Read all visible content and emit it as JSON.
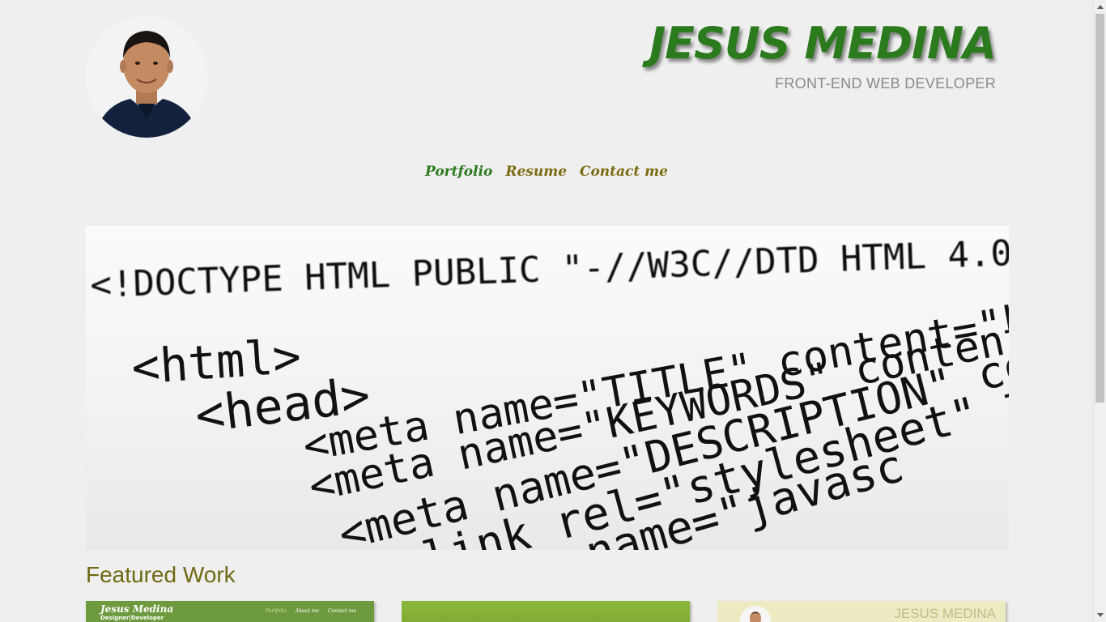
{
  "header": {
    "name": "JESUS MEDINA",
    "subtitle": "FRONT-END WEB DEVELOPER"
  },
  "nav": {
    "items": [
      {
        "label": "Portfolio",
        "active": true
      },
      {
        "label": "Resume",
        "active": false
      },
      {
        "label": "Contact me",
        "active": false
      }
    ]
  },
  "hero": {
    "code_lines": [
      "<!DOCTYPE HTML PUBLIC \"-//W3C//DTD HTML 4.0",
      "<html>",
      "<head>",
      "<meta name=\"TITLE\" content=\"keywords",
      "<meta name=\"KEYWORDS\" content=\"st",
      "<meta name=\"DESCRIPTION\" conte",
      "<link rel=\"stylesheet\" type=",
      "<meta name=\"javasc"
    ]
  },
  "featured": {
    "heading": "Featured Work",
    "thumbs": [
      {
        "title": "Jesus Medina",
        "subtitle": "Designer|Developer",
        "nav": [
          "Portfolio",
          "About me",
          "Contact me"
        ]
      },
      {},
      {
        "title": "JESUS MEDINA"
      }
    ]
  },
  "colors": {
    "brand_green": "#2b7a1d",
    "nav_olive": "#7a6a10",
    "background": "#efefef"
  }
}
